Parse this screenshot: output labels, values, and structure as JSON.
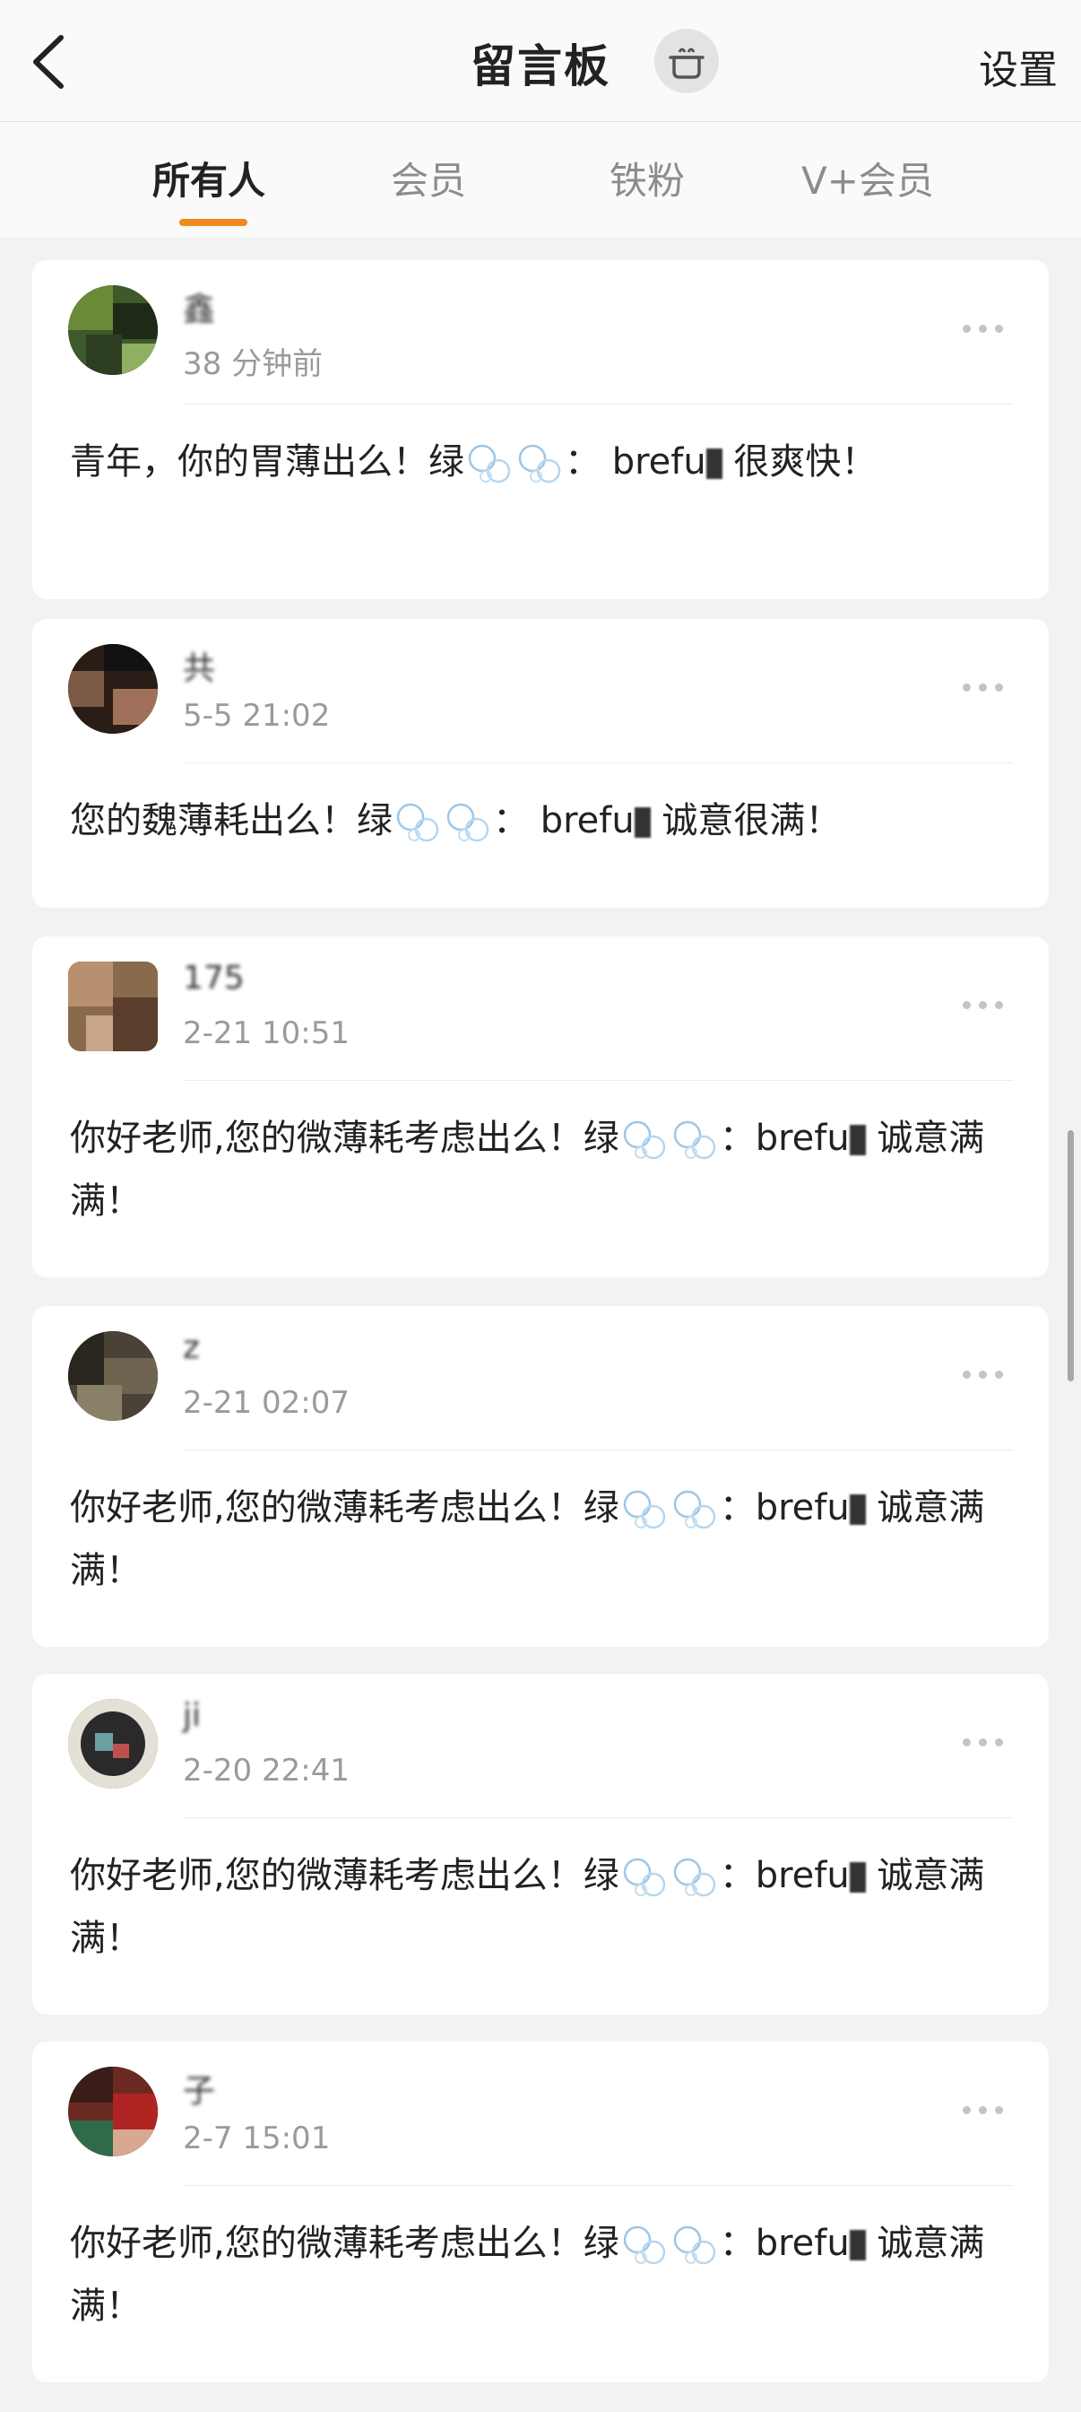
{
  "header": {
    "title": "留言板",
    "settings_label": "设置"
  },
  "tabs": [
    {
      "label": "所有人",
      "active": true
    },
    {
      "label": "会员",
      "active": false
    },
    {
      "label": "铁粉",
      "active": false
    },
    {
      "label": "V+会员",
      "active": false
    }
  ],
  "accent_color": "#f08a1d",
  "posts": [
    {
      "username": "鑫",
      "time": "38 分钟前",
      "message_before": "青年，你的胃薄出么！绿",
      "message_mid": "：  brefu",
      "message_after": "   很爽快！"
    },
    {
      "username": "共",
      "time": "5-5 21:02",
      "message_before": "您的魏薄耗出么！绿",
      "message_mid": "：  brefu",
      "message_after": " 诚意很满！"
    },
    {
      "username": "175",
      "time": "2-21 10:51",
      "message_before": "你好老师,您的微薄耗考虑出么！绿",
      "message_mid": "：brefu",
      "message_after": " 诚意满满！"
    },
    {
      "username": "z",
      "time": "2-21 02:07",
      "message_before": "你好老师,您的微薄耗考虑出么！绿",
      "message_mid": "：brefu",
      "message_after": " 诚意满满！"
    },
    {
      "username": "ji",
      "time": "2-20 22:41",
      "message_before": "你好老师,您的微薄耗考虑出么！绿",
      "message_mid": "：brefu",
      "message_after": " 诚意满满！"
    },
    {
      "username": "子",
      "time": "2-7 15:01",
      "message_before": "你好老师,您的微薄耗考虑出么！绿",
      "message_mid": "：brefu",
      "message_after": " 诚意满满！"
    }
  ]
}
